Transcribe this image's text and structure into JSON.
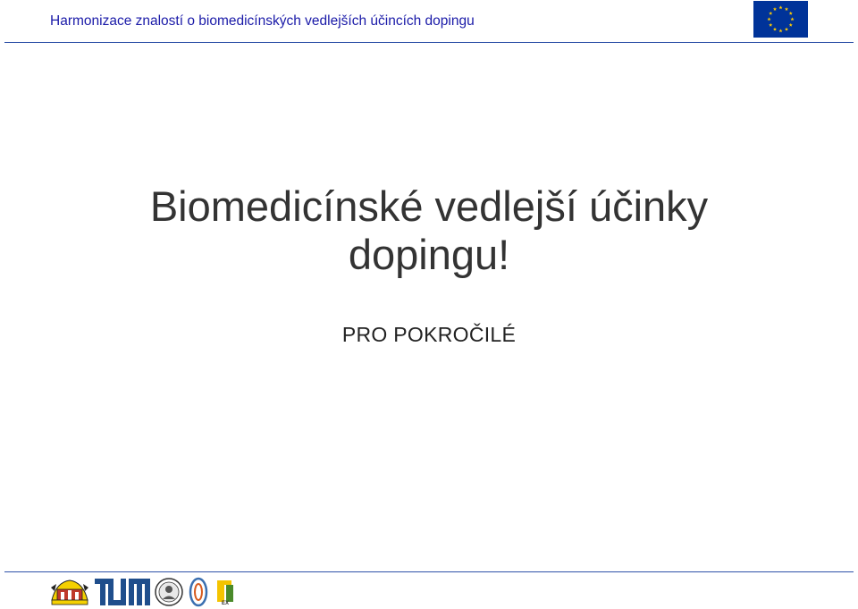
{
  "header": {
    "title": "Harmonizace znalostí o biomedicínských vedlejších účincích dopingu",
    "flag_icon": "eu-flag-icon",
    "flag_color": "#003399",
    "star_color": "#ffcc00"
  },
  "slide": {
    "title_line1": "Biomedicínské vedlejší účinky",
    "title_line2": "dopingu!",
    "subtitle": "PRO POKROČILÉ"
  },
  "footer": {
    "logos": [
      "university-crest-logo",
      "tum-logo",
      "university-seal-logo",
      "oval-emblem-logo",
      "tex-logo"
    ],
    "logo_text": {
      "tum": "TUM",
      "tex": "EX"
    }
  },
  "colors": {
    "header_text": "#1a1aa8",
    "rule": "#2f52a8",
    "title_text": "#333333",
    "tum_blue": "#1f4e8c"
  }
}
